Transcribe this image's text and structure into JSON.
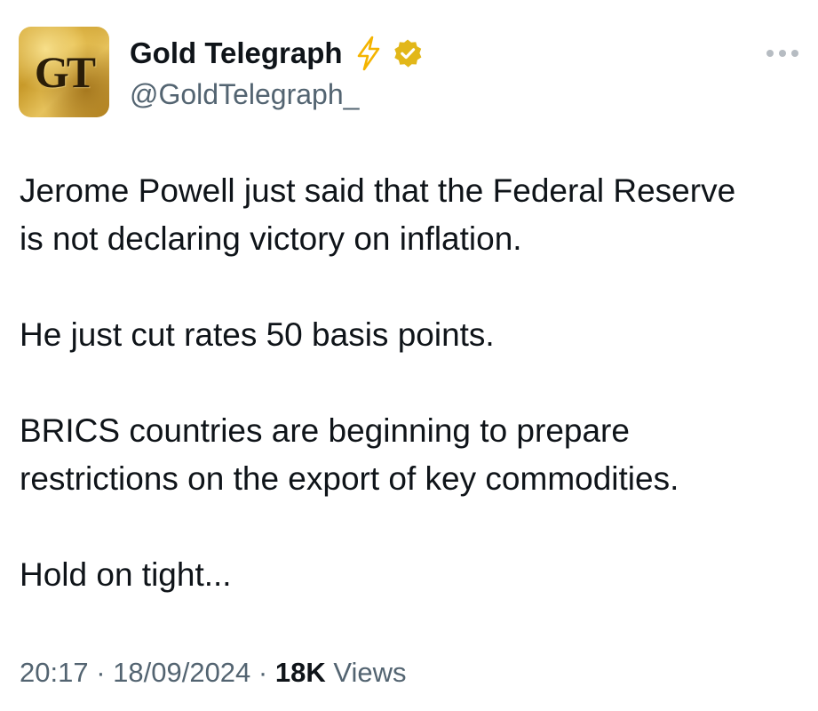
{
  "author": {
    "avatar_text": "GT",
    "display_name": "Gold Telegraph",
    "handle": "@GoldTelegraph_",
    "badge_icons": [
      "lightning-bolt-icon",
      "gold-verified-badge-icon"
    ],
    "colors": {
      "bolt": "#f4b400",
      "verified_badge": "#e2b719",
      "avatar_gold": "#d9ad3c"
    }
  },
  "more_menu_icon": "more-dots-icon",
  "tweet": {
    "paragraphs": [
      "Jerome Powell just said that the Federal Reserve\nis not declaring victory on inflation.",
      "He just cut rates 50 basis points.",
      "BRICS countries are beginning to prepare\nrestrictions on the export of key commodities.",
      "Hold on tight..."
    ]
  },
  "meta": {
    "time": "20:17",
    "separator": " · ",
    "date": "18/09/2024",
    "views_count": "18K",
    "views_label": " Views"
  }
}
